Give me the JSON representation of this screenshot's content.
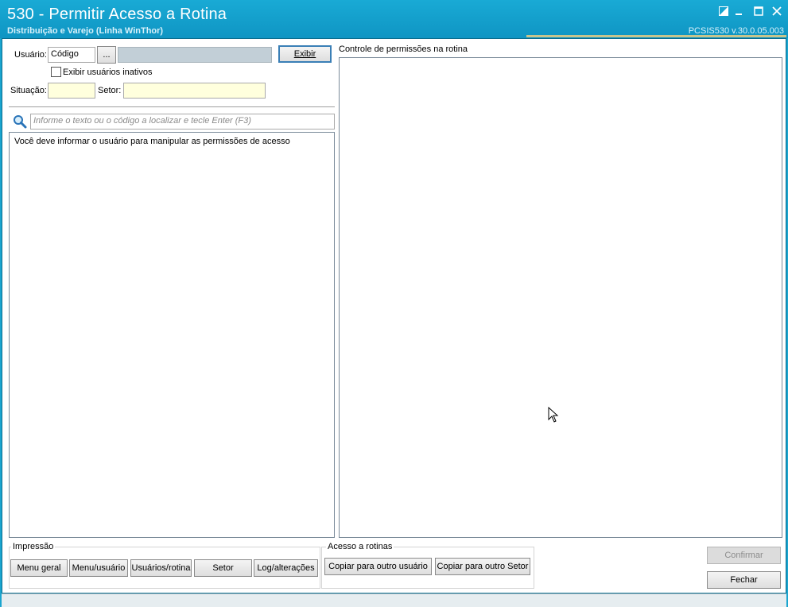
{
  "window": {
    "title": "530 - Permitir Acesso a Rotina",
    "subtitle": "Distribuição e Varejo (Linha WinThor)",
    "version": "PCSIS530  v.30.0.05.003"
  },
  "filters": {
    "usuario_label": "Usuário:",
    "codigo_placeholder": "Código",
    "lookup_label": "...",
    "user_name_value": "",
    "exibir_label": "Exibir",
    "inativos_label": "Exibir usuários inativos",
    "inativos_checked": false,
    "situacao_label": "Situação:",
    "situacao_value": "",
    "setor_label": "Setor:",
    "setor_value": ""
  },
  "search": {
    "placeholder": "Informe o texto ou o código a localizar e tecle Enter (F3)"
  },
  "left_panel": {
    "message": "Você deve informar o usuário para manipular as permissões de acesso"
  },
  "right_panel": {
    "title": "Controle de permissões na rotina"
  },
  "impressao": {
    "title": "Impressão",
    "buttons": [
      "Menu geral",
      "Menu/usuário",
      "Usuários/rotina",
      "Setor",
      "Log/alterações"
    ]
  },
  "acesso": {
    "title": "Acesso a rotinas",
    "buttons": [
      "Copiar para outro usuário",
      "Copiar para outro Setor"
    ]
  },
  "actions": {
    "confirmar_label": "Confirmar",
    "fechar_label": "Fechar"
  }
}
